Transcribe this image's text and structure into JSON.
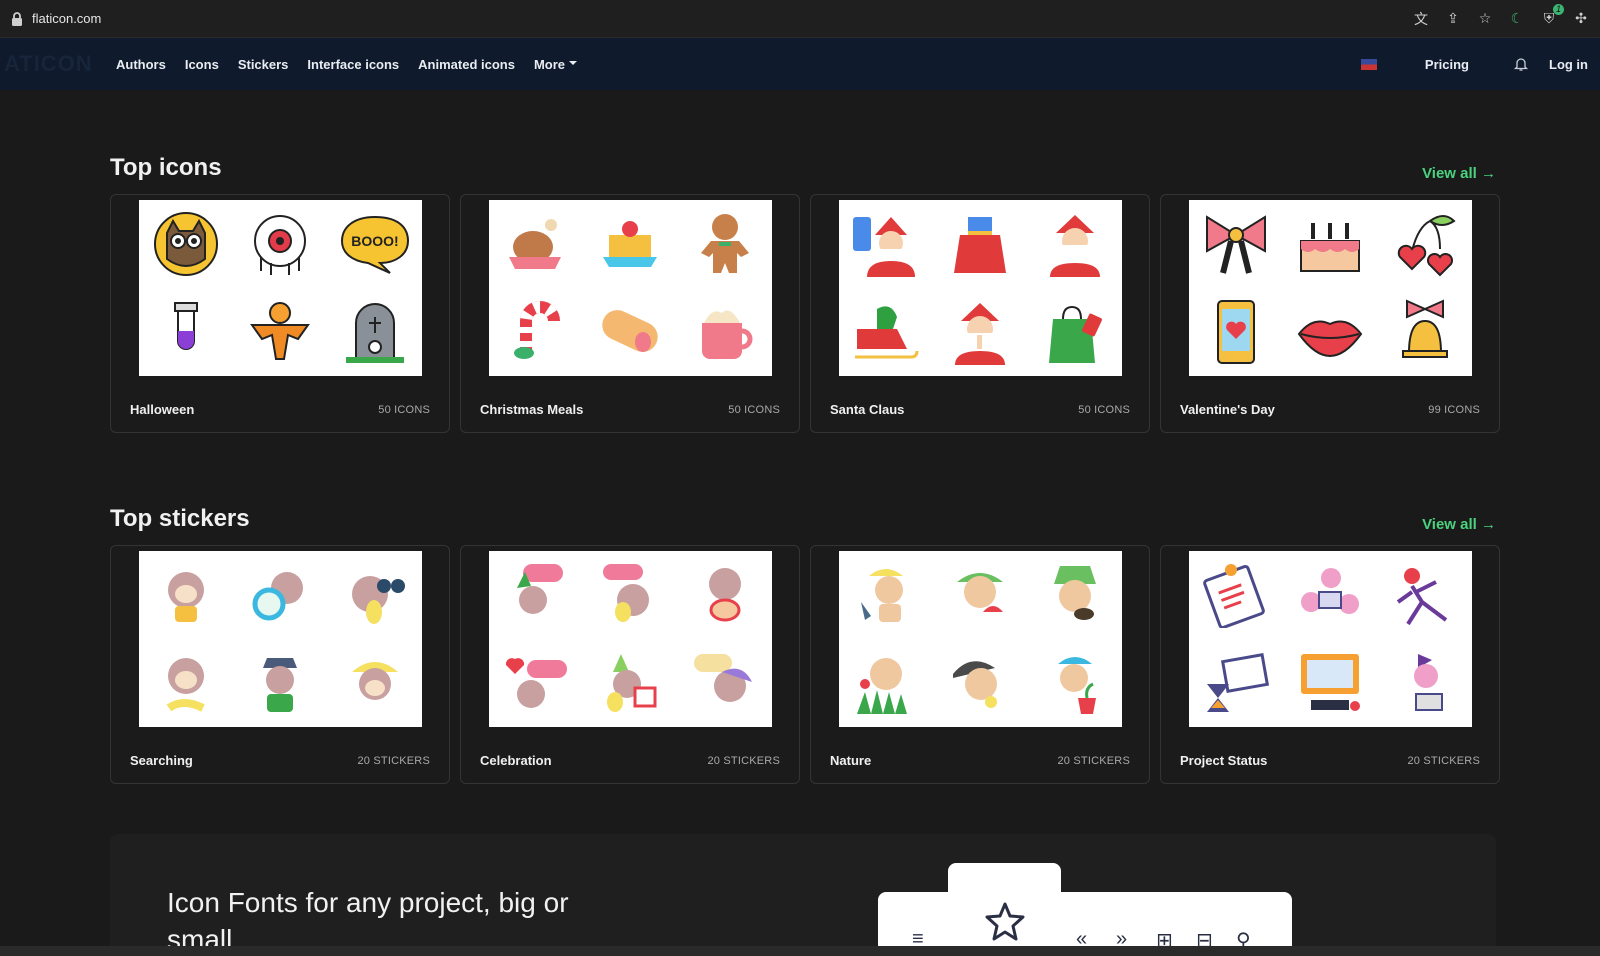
{
  "browser": {
    "url": "flaticon.com",
    "ext_badge": "1"
  },
  "nav": {
    "logo": "ATICON",
    "links": [
      "Authors",
      "Icons",
      "Stickers",
      "Interface icons",
      "Animated icons",
      "More"
    ],
    "pricing": "Pricing",
    "login": "Log in"
  },
  "top_icons": {
    "title": "Top icons",
    "view_all": "View all →",
    "cards": [
      {
        "name": "Halloween",
        "count": "50 ICONS"
      },
      {
        "name": "Christmas Meals",
        "count": "50 ICONS"
      },
      {
        "name": "Santa Claus",
        "count": "50 ICONS"
      },
      {
        "name": "Valentine's Day",
        "count": "99 ICONS"
      }
    ]
  },
  "top_stickers": {
    "title": "Top stickers",
    "view_all": "View all →",
    "cards": [
      {
        "name": "Searching",
        "count": "20 STICKERS"
      },
      {
        "name": "Celebration",
        "count": "20 STICKERS"
      },
      {
        "name": "Nature",
        "count": "20 STICKERS"
      },
      {
        "name": "Project Status",
        "count": "20 STICKERS"
      }
    ]
  },
  "banner": {
    "title": "Icon Fonts for any project, big or small"
  },
  "colors": {
    "accent": "#4ad27e",
    "nav_bg": "#0f1a2c",
    "page_bg": "#1a1a1a"
  }
}
